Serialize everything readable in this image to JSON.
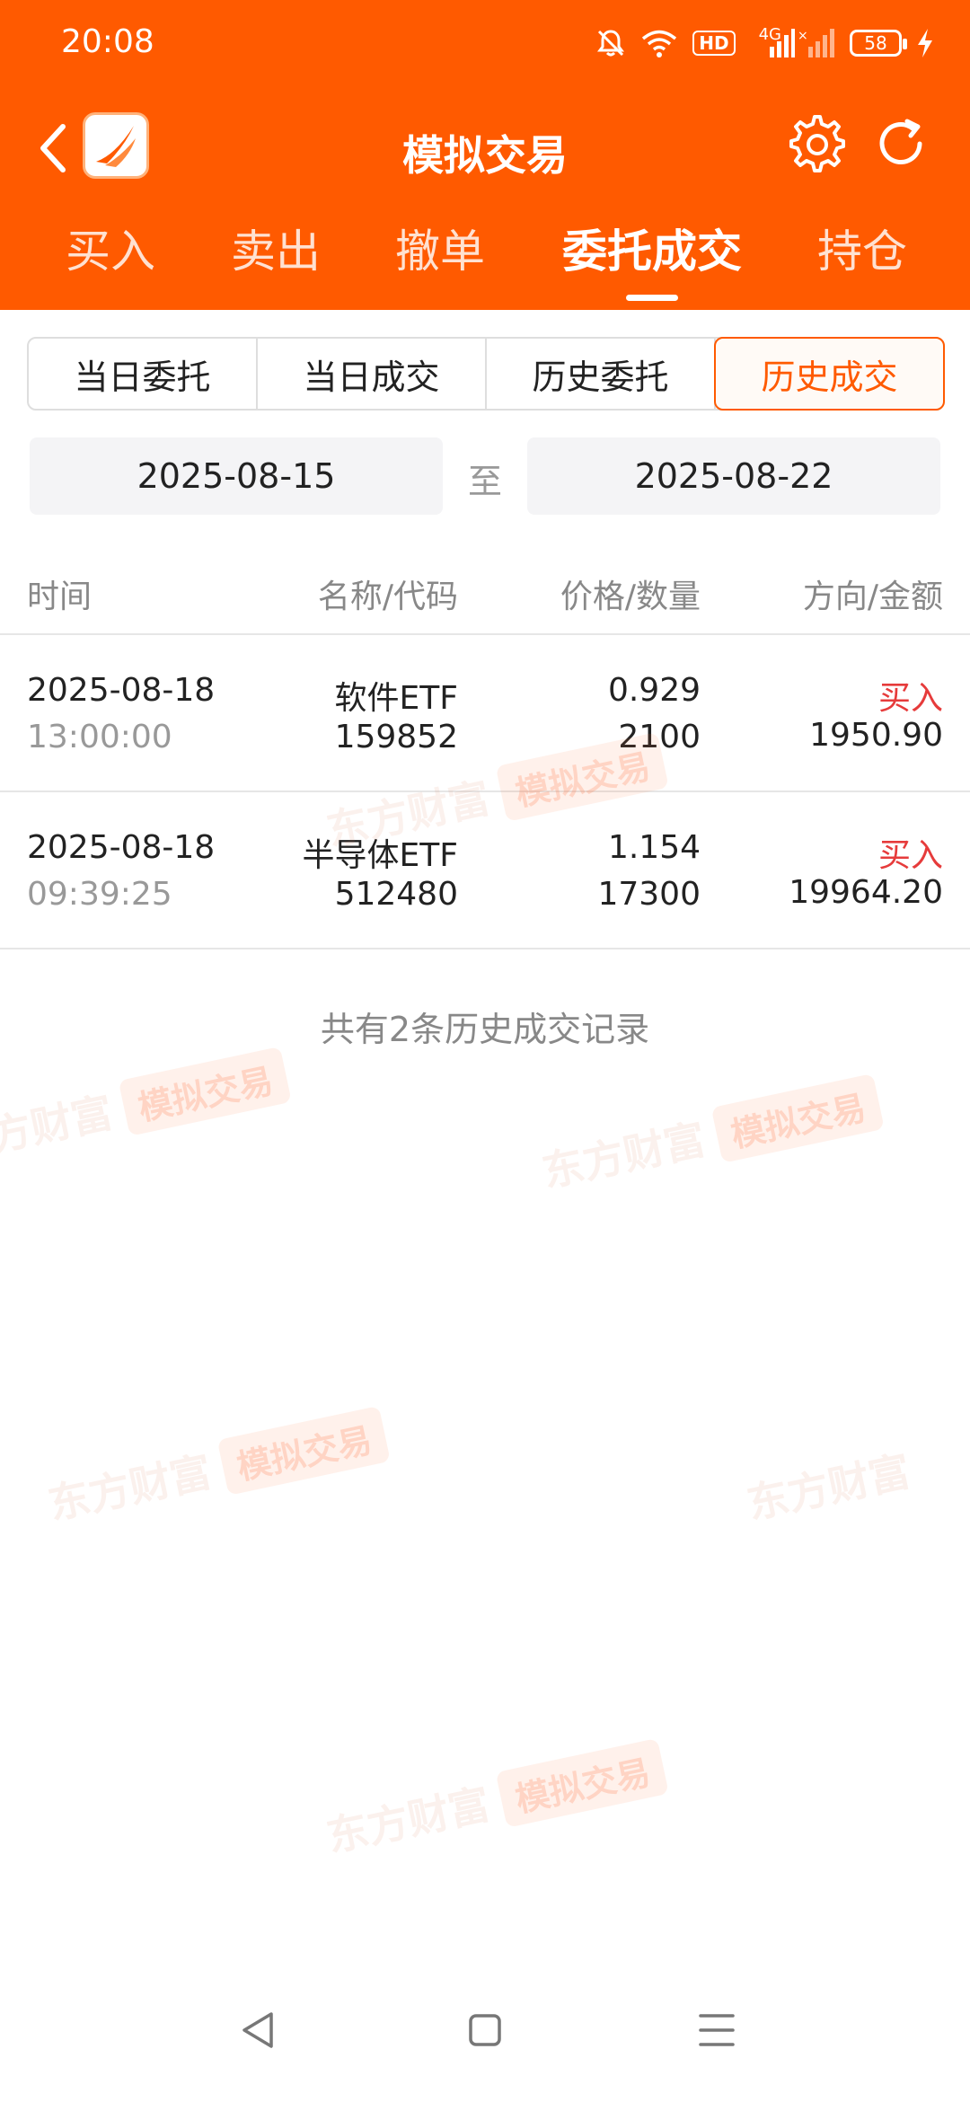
{
  "status": {
    "time": "20:08",
    "hd": "HD",
    "network": "4G",
    "battery": "58"
  },
  "header": {
    "title": "模拟交易"
  },
  "tabs": [
    {
      "label": "买入",
      "active": false
    },
    {
      "label": "卖出",
      "active": false
    },
    {
      "label": "撤单",
      "active": false
    },
    {
      "label": "委托成交",
      "active": true
    },
    {
      "label": "持仓",
      "active": false
    }
  ],
  "segments": [
    {
      "label": "当日委托",
      "active": false
    },
    {
      "label": "当日成交",
      "active": false
    },
    {
      "label": "历史委托",
      "active": false
    },
    {
      "label": "历史成交",
      "active": true
    }
  ],
  "dates": {
    "from": "2025-08-15",
    "separator": "至",
    "to": "2025-08-22"
  },
  "table": {
    "headers": [
      "时间",
      "名称/代码",
      "价格/数量",
      "方向/金额"
    ],
    "rows": [
      {
        "date": "2025-08-18",
        "time": "13:00:00",
        "name": "软件ETF",
        "code": "159852",
        "price": "0.929",
        "qty": "2100",
        "direction": "买入",
        "amount": "1950.90"
      },
      {
        "date": "2025-08-18",
        "time": "09:39:25",
        "name": "半导体ETF",
        "code": "512480",
        "price": "1.154",
        "qty": "17300",
        "direction": "买入",
        "amount": "19964.20"
      }
    ]
  },
  "summary": "共有2条历史成交记录",
  "watermark": {
    "text": "东方财富",
    "badge": "模拟交易"
  },
  "colors": {
    "brand": "#ff5a00",
    "buy": "#e63b3b"
  }
}
